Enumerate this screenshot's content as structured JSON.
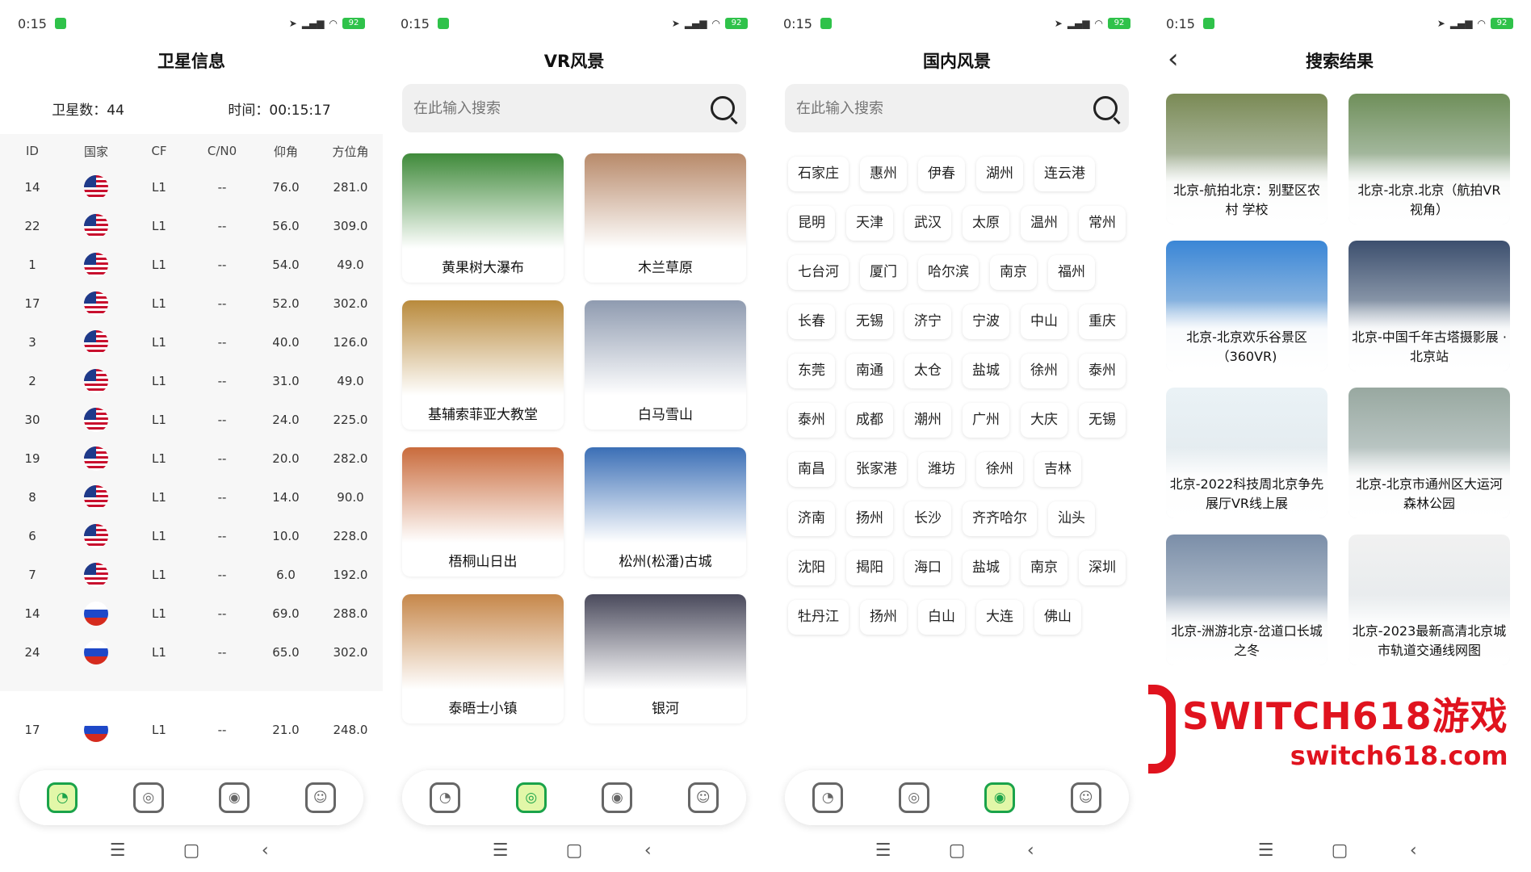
{
  "status": {
    "time": "0:15",
    "battery": "92"
  },
  "satellite": {
    "title": "卫星信息",
    "count_label": "卫星数：44",
    "time_label": "时间：00:15:17",
    "columns": [
      "ID",
      "国家",
      "CF",
      "C/N0",
      "仰角",
      "方位角"
    ],
    "rows": [
      {
        "id": "14",
        "flag": "us",
        "cf": "L1",
        "cn0": "--",
        "elev": "76.0",
        "azim": "281.0"
      },
      {
        "id": "22",
        "flag": "us",
        "cf": "L1",
        "cn0": "--",
        "elev": "56.0",
        "azim": "309.0"
      },
      {
        "id": "1",
        "flag": "us",
        "cf": "L1",
        "cn0": "--",
        "elev": "54.0",
        "azim": "49.0"
      },
      {
        "id": "17",
        "flag": "us",
        "cf": "L1",
        "cn0": "--",
        "elev": "52.0",
        "azim": "302.0"
      },
      {
        "id": "3",
        "flag": "us",
        "cf": "L1",
        "cn0": "--",
        "elev": "40.0",
        "azim": "126.0"
      },
      {
        "id": "2",
        "flag": "us",
        "cf": "L1",
        "cn0": "--",
        "elev": "31.0",
        "azim": "49.0"
      },
      {
        "id": "30",
        "flag": "us",
        "cf": "L1",
        "cn0": "--",
        "elev": "24.0",
        "azim": "225.0"
      },
      {
        "id": "19",
        "flag": "us",
        "cf": "L1",
        "cn0": "--",
        "elev": "20.0",
        "azim": "282.0"
      },
      {
        "id": "8",
        "flag": "us",
        "cf": "L1",
        "cn0": "--",
        "elev": "14.0",
        "azim": "90.0"
      },
      {
        "id": "6",
        "flag": "us",
        "cf": "L1",
        "cn0": "--",
        "elev": "10.0",
        "azim": "228.0"
      },
      {
        "id": "7",
        "flag": "us",
        "cf": "L1",
        "cn0": "--",
        "elev": "6.0",
        "azim": "192.0"
      },
      {
        "id": "14",
        "flag": "ru",
        "cf": "L1",
        "cn0": "--",
        "elev": "69.0",
        "azim": "288.0"
      },
      {
        "id": "24",
        "flag": "ru",
        "cf": "L1",
        "cn0": "--",
        "elev": "65.0",
        "azim": "302.0"
      },
      {
        "id": "",
        "flag": "",
        "cf": "",
        "cn0": "",
        "elev": "",
        "azim": ""
      },
      {
        "id": "17",
        "flag": "ru",
        "cf": "L1",
        "cn0": "--",
        "elev": "21.0",
        "azim": "248.0"
      }
    ]
  },
  "vr": {
    "title": "VR风景",
    "search_placeholder": "在此输入搜索",
    "items": [
      {
        "label": "黄果树大瀑布",
        "color": "#3f8a3a"
      },
      {
        "label": "木兰草原",
        "color": "#b88a6a"
      },
      {
        "label": "基辅索菲亚大教堂",
        "color": "#b98a3c"
      },
      {
        "label": "白马雪山",
        "color": "#8f9bb0"
      },
      {
        "label": "梧桐山日出",
        "color": "#c96b3c"
      },
      {
        "label": "松州(松潘)古城",
        "color": "#3b6fb6"
      },
      {
        "label": "泰晤士小镇",
        "color": "#c6874a"
      },
      {
        "label": "银河",
        "color": "#4a4a5c"
      }
    ]
  },
  "domestic": {
    "title": "国内风景",
    "search_placeholder": "在此输入搜索",
    "cities": [
      "石家庄",
      "惠州",
      "伊春",
      "湖州",
      "连云港",
      "昆明",
      "天津",
      "武汉",
      "太原",
      "温州",
      "常州",
      "七台河",
      "厦门",
      "哈尔滨",
      "南京",
      "福州",
      "长春",
      "无锡",
      "济宁",
      "宁波",
      "中山",
      "重庆",
      "东莞",
      "南通",
      "太仓",
      "盐城",
      "徐州",
      "泰州",
      "泰州",
      "成都",
      "潮州",
      "广州",
      "大庆",
      "无锡",
      "南昌",
      "张家港",
      "潍坊",
      "徐州",
      "吉林",
      "济南",
      "扬州",
      "长沙",
      "齐齐哈尔",
      "汕头",
      "沈阳",
      "揭阳",
      "海口",
      "盐城",
      "南京",
      "深圳",
      "牡丹江",
      "扬州",
      "白山",
      "大连",
      "佛山"
    ]
  },
  "results": {
    "title": "搜索结果",
    "items": [
      {
        "label": "北京-航拍北京：别墅区农村 学校",
        "color": "#7a8a55"
      },
      {
        "label": "北京-北京.北京（航拍VR视角）",
        "color": "#6f8f5a"
      },
      {
        "label": "北京-北京欢乐谷景区（360VR)",
        "color": "#3a86d6"
      },
      {
        "label": "北京-中国千年古塔摄影展 · 北京站",
        "color": "#3c4f6e"
      },
      {
        "label": "北京-2022科技周北京争先展厅VR线上展",
        "color": "#eaf2f6"
      },
      {
        "label": "北京-北京市通州区大运河森林公园",
        "color": "#98a8a0"
      },
      {
        "label": "北京-洲游北京-岔道口长城之冬",
        "color": "#7b8ea8"
      },
      {
        "label": "北京-2023最新高清北京城市轨道交通线网图",
        "color": "#f1f1f1"
      }
    ]
  },
  "watermark": {
    "line1": "SWITCH618游戏",
    "line2": "switch618.com"
  },
  "colors": {
    "accent": "#1aa34a",
    "watermark": "#e0131e"
  }
}
